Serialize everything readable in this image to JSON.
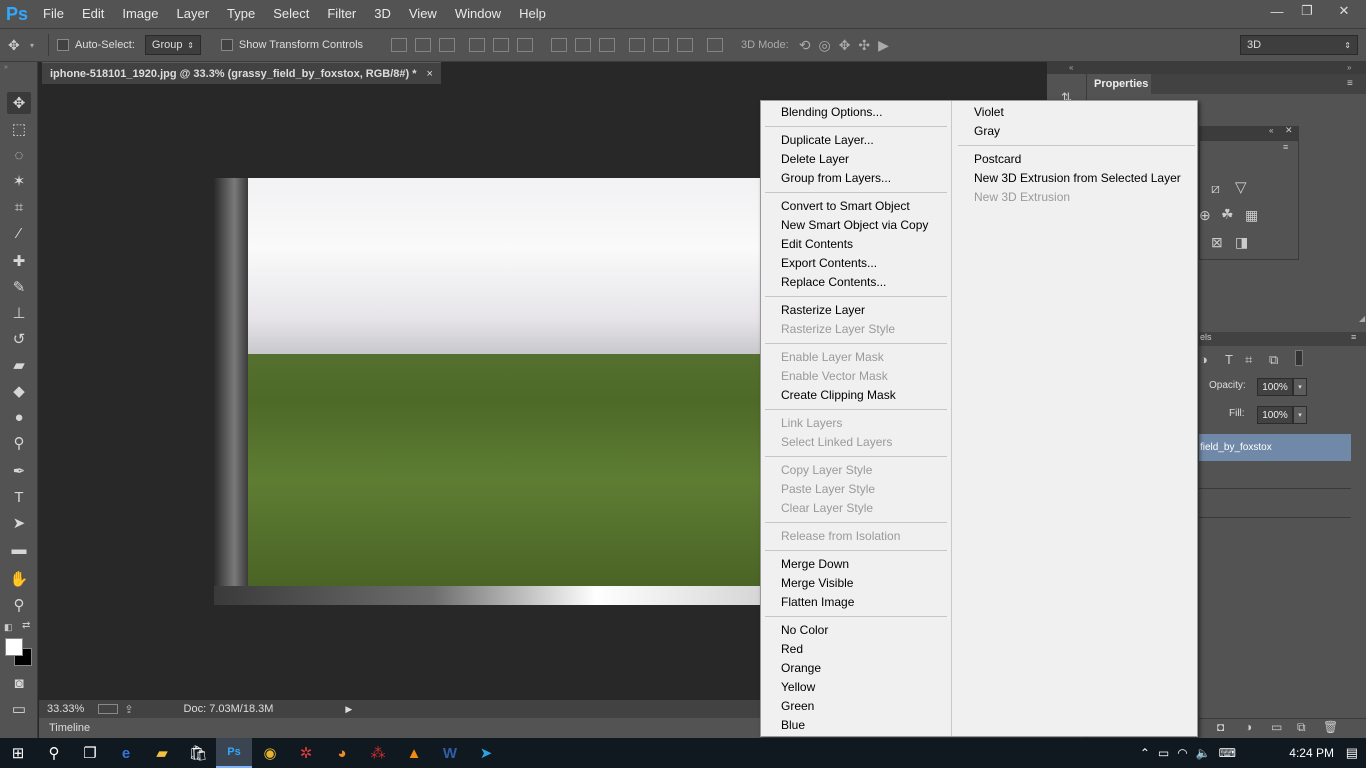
{
  "app": {
    "logo": "Ps"
  },
  "menubar": {
    "items": [
      "File",
      "Edit",
      "Image",
      "Layer",
      "Type",
      "Select",
      "Filter",
      "3D",
      "View",
      "Window",
      "Help"
    ]
  },
  "window_controls": {
    "minimize": "—",
    "restore": "❐",
    "close": "✕"
  },
  "options": {
    "auto_select_label": "Auto-Select:",
    "auto_select_value": "Group",
    "transform_label": "Show Transform Controls",
    "mode_3d_label": "3D Mode:",
    "workspace_value": "3D"
  },
  "document": {
    "tab_title": "iphone-518101_1920.jpg @ 33.3% (grassy_field_by_foxstox, RGB/8#) *",
    "tab_close": "×",
    "zoom": "33.33%",
    "doc_info": "Doc: 7.03M/18.3M",
    "timeline": "Timeline"
  },
  "panels": {
    "properties_tab": "Properties",
    "layers_tab_partial": "els",
    "opacity_label": "Opacity:",
    "opacity_value": "100%",
    "fill_label": "Fill:",
    "fill_value": "100%",
    "layer_name": "field_by_foxstox"
  },
  "context_menu": {
    "col1": [
      {
        "label": "Blending Options...",
        "enabled": true
      },
      {
        "sep": true
      },
      {
        "label": "Duplicate Layer...",
        "enabled": true
      },
      {
        "label": "Delete Layer",
        "enabled": true
      },
      {
        "label": "Group from Layers...",
        "enabled": true
      },
      {
        "sep": true
      },
      {
        "label": "Convert to Smart Object",
        "enabled": true
      },
      {
        "label": "New Smart Object via Copy",
        "enabled": true
      },
      {
        "label": "Edit Contents",
        "enabled": true
      },
      {
        "label": "Export Contents...",
        "enabled": true
      },
      {
        "label": "Replace Contents...",
        "enabled": true
      },
      {
        "sep": true
      },
      {
        "label": "Rasterize Layer",
        "enabled": true
      },
      {
        "label": "Rasterize Layer Style",
        "enabled": false
      },
      {
        "sep": true
      },
      {
        "label": "Enable Layer Mask",
        "enabled": false
      },
      {
        "label": "Enable Vector Mask",
        "enabled": false
      },
      {
        "label": "Create Clipping Mask",
        "enabled": true
      },
      {
        "sep": true
      },
      {
        "label": "Link Layers",
        "enabled": false
      },
      {
        "label": "Select Linked Layers",
        "enabled": false
      },
      {
        "sep": true
      },
      {
        "label": "Copy Layer Style",
        "enabled": false
      },
      {
        "label": "Paste Layer Style",
        "enabled": false
      },
      {
        "label": "Clear Layer Style",
        "enabled": false
      },
      {
        "sep": true
      },
      {
        "label": "Release from Isolation",
        "enabled": false
      },
      {
        "sep": true
      },
      {
        "label": "Merge Down",
        "enabled": true
      },
      {
        "label": "Merge Visible",
        "enabled": true
      },
      {
        "label": "Flatten Image",
        "enabled": true
      },
      {
        "sep": true
      },
      {
        "label": "No Color",
        "enabled": true
      },
      {
        "label": "Red",
        "enabled": true
      },
      {
        "label": "Orange",
        "enabled": true
      },
      {
        "label": "Yellow",
        "enabled": true
      },
      {
        "label": "Green",
        "enabled": true
      },
      {
        "label": "Blue",
        "enabled": true
      }
    ],
    "col2": [
      {
        "label": "Violet",
        "enabled": true
      },
      {
        "label": "Gray",
        "enabled": true
      },
      {
        "sep": true
      },
      {
        "label": "Postcard",
        "enabled": true
      },
      {
        "label": "New 3D Extrusion from Selected Layer",
        "enabled": true
      },
      {
        "label": "New 3D Extrusion",
        "enabled": false
      }
    ]
  },
  "taskbar": {
    "time": "4:24 PM",
    "apps": [
      "windows-start-icon",
      "search-icon",
      "task-view-icon",
      "edge-icon",
      "file-explorer-icon",
      "store-icon",
      "photoshop-icon",
      "chrome-icon",
      "app-red-icon",
      "firefox-icon",
      "app-berry-icon",
      "vlc-icon",
      "word-icon",
      "telegram-icon"
    ]
  },
  "colors": {
    "accent": "#31a8ff",
    "panel": "#535353",
    "canvas_bg": "#282828",
    "menu_bg": "#f0f0f0",
    "selected_layer": "#7189a8"
  }
}
